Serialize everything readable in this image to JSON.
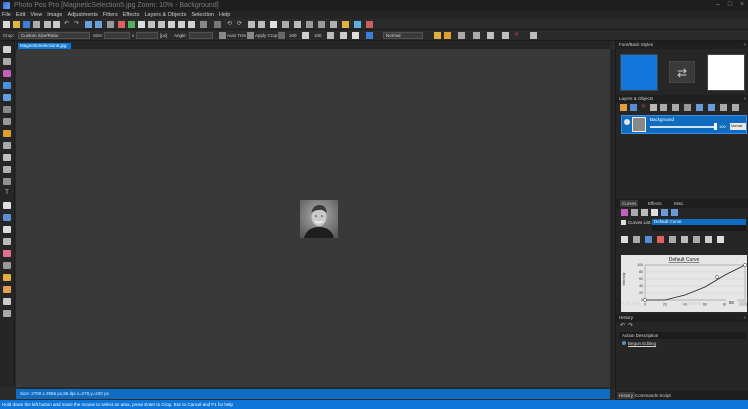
{
  "window": {
    "title": "Photo Pos Pro [MagneticSelection5.jpg Zoom: 10% - Background]",
    "controls": [
      "–",
      "□",
      "×"
    ]
  },
  "menu": [
    "File",
    "Edit",
    "View",
    "Image",
    "Adjustments",
    "Filters",
    "Effects",
    "Layers & Objects",
    "Selection",
    "Help"
  ],
  "crop_bar": {
    "crop_label": "Crop:",
    "crop_mode": "Custom Size/Ratio",
    "size_label": "Size:",
    "x_label": "x",
    "unit_label": "[px]",
    "angle_label": "Angle:",
    "auto_trim": "Auto Trim",
    "apply_crop": "Apply Crop",
    "opacity_1": "100",
    "opacity_2": "100",
    "blend_mode": "Normal"
  },
  "document": {
    "tab": "MagneticSelection5.jpg",
    "status": "Size: 2780 x 2965 px,96 dpi   x=270,y=230 px",
    "hint": "Hold down the left button and move the mouse to select an area, press Enter to Crop, Esc to Cancel and F1 for help"
  },
  "colors": {
    "accent": "#0f6cc0",
    "foreground": "#1177dd",
    "background": "#ffffff"
  },
  "fore_back": {
    "title": "Fore/Back Styles"
  },
  "layers": {
    "title": "Layers & Objects",
    "items": [
      {
        "name": "Background",
        "opacity": "100",
        "blend": "Normal"
      }
    ]
  },
  "curves": {
    "tabs": [
      "Curves",
      "Effects",
      "Misc."
    ],
    "list_label": "Curves List:",
    "selected": "Default Curve",
    "chart_title": "Default Curve",
    "y_axis_label": "Intensity",
    "y_ticks": [
      "100",
      "80",
      "60",
      "40",
      "20",
      "0"
    ],
    "x_ticks": [
      "0",
      "20",
      "40",
      "60",
      "80",
      "100"
    ],
    "x_axis_label": "Brightness",
    "coords": "X=0, Y=0",
    "value": "50"
  },
  "history": {
    "title": "History",
    "column": "Action Description",
    "items": [
      "Begun Editing"
    ]
  },
  "bottom_tabs": [
    "History",
    "Commands Script"
  ]
}
